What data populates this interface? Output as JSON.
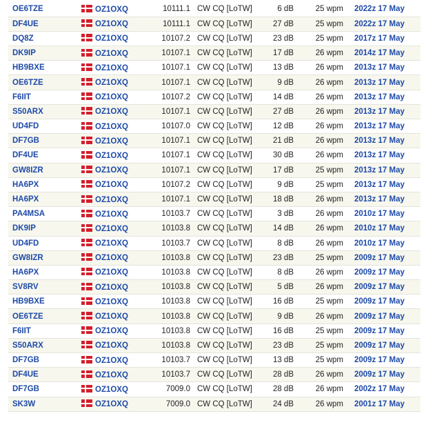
{
  "flag_colors": {
    "red": "#d21f2b",
    "cross": "#ffffff"
  },
  "rows": [
    {
      "spotter": "OE6TZE",
      "dx": "OZ1OXQ",
      "freq": "10111.1",
      "mode": "CW CQ [LoTW]",
      "snr": "6 dB",
      "speed": "25 wpm",
      "time": "2022z 17 May"
    },
    {
      "spotter": "DF4UE",
      "dx": "OZ1OXQ",
      "freq": "10111.1",
      "mode": "CW CQ [LoTW]",
      "snr": "27 dB",
      "speed": "25 wpm",
      "time": "2022z 17 May"
    },
    {
      "spotter": "DQ8Z",
      "dx": "OZ1OXQ",
      "freq": "10107.2",
      "mode": "CW CQ [LoTW]",
      "snr": "23 dB",
      "speed": "25 wpm",
      "time": "2017z 17 May"
    },
    {
      "spotter": "DK9IP",
      "dx": "OZ1OXQ",
      "freq": "10107.1",
      "mode": "CW CQ [LoTW]",
      "snr": "17 dB",
      "speed": "26 wpm",
      "time": "2014z 17 May"
    },
    {
      "spotter": "HB9BXE",
      "dx": "OZ1OXQ",
      "freq": "10107.1",
      "mode": "CW CQ [LoTW]",
      "snr": "13 dB",
      "speed": "26 wpm",
      "time": "2013z 17 May"
    },
    {
      "spotter": "OE6TZE",
      "dx": "OZ1OXQ",
      "freq": "10107.1",
      "mode": "CW CQ [LoTW]",
      "snr": "9 dB",
      "speed": "26 wpm",
      "time": "2013z 17 May"
    },
    {
      "spotter": "F6IIT",
      "dx": "OZ1OXQ",
      "freq": "10107.2",
      "mode": "CW CQ [LoTW]",
      "snr": "14 dB",
      "speed": "26 wpm",
      "time": "2013z 17 May"
    },
    {
      "spotter": "S50ARX",
      "dx": "OZ1OXQ",
      "freq": "10107.1",
      "mode": "CW CQ [LoTW]",
      "snr": "27 dB",
      "speed": "26 wpm",
      "time": "2013z 17 May"
    },
    {
      "spotter": "UD4FD",
      "dx": "OZ1OXQ",
      "freq": "10107.0",
      "mode": "CW CQ [LoTW]",
      "snr": "12 dB",
      "speed": "26 wpm",
      "time": "2013z 17 May"
    },
    {
      "spotter": "DF7GB",
      "dx": "OZ1OXQ",
      "freq": "10107.1",
      "mode": "CW CQ [LoTW]",
      "snr": "21 dB",
      "speed": "26 wpm",
      "time": "2013z 17 May"
    },
    {
      "spotter": "DF4UE",
      "dx": "OZ1OXQ",
      "freq": "10107.1",
      "mode": "CW CQ [LoTW]",
      "snr": "30 dB",
      "speed": "26 wpm",
      "time": "2013z 17 May"
    },
    {
      "spotter": "GW8IZR",
      "dx": "OZ1OXQ",
      "freq": "10107.1",
      "mode": "CW CQ [LoTW]",
      "snr": "17 dB",
      "speed": "25 wpm",
      "time": "2013z 17 May"
    },
    {
      "spotter": "HA6PX",
      "dx": "OZ1OXQ",
      "freq": "10107.2",
      "mode": "CW CQ [LoTW]",
      "snr": "9 dB",
      "speed": "25 wpm",
      "time": "2013z 17 May"
    },
    {
      "spotter": "HA6PX",
      "dx": "OZ1OXQ",
      "freq": "10107.1",
      "mode": "CW CQ [LoTW]",
      "snr": "18 dB",
      "speed": "26 wpm",
      "time": "2013z 17 May"
    },
    {
      "spotter": "PA4MSA",
      "dx": "OZ1OXQ",
      "freq": "10103.7",
      "mode": "CW CQ [LoTW]",
      "snr": "3 dB",
      "speed": "26 wpm",
      "time": "2010z 17 May"
    },
    {
      "spotter": "DK9IP",
      "dx": "OZ1OXQ",
      "freq": "10103.8",
      "mode": "CW CQ [LoTW]",
      "snr": "14 dB",
      "speed": "26 wpm",
      "time": "2010z 17 May"
    },
    {
      "spotter": "UD4FD",
      "dx": "OZ1OXQ",
      "freq": "10103.7",
      "mode": "CW CQ [LoTW]",
      "snr": "8 dB",
      "speed": "26 wpm",
      "time": "2010z 17 May"
    },
    {
      "spotter": "GW8IZR",
      "dx": "OZ1OXQ",
      "freq": "10103.8",
      "mode": "CW CQ [LoTW]",
      "snr": "23 dB",
      "speed": "25 wpm",
      "time": "2009z 17 May"
    },
    {
      "spotter": "HA6PX",
      "dx": "OZ1OXQ",
      "freq": "10103.8",
      "mode": "CW CQ [LoTW]",
      "snr": "8 dB",
      "speed": "26 wpm",
      "time": "2009z 17 May"
    },
    {
      "spotter": "SV8RV",
      "dx": "OZ1OXQ",
      "freq": "10103.8",
      "mode": "CW CQ [LoTW]",
      "snr": "5 dB",
      "speed": "26 wpm",
      "time": "2009z 17 May"
    },
    {
      "spotter": "HB9BXE",
      "dx": "OZ1OXQ",
      "freq": "10103.8",
      "mode": "CW CQ [LoTW]",
      "snr": "16 dB",
      "speed": "25 wpm",
      "time": "2009z 17 May"
    },
    {
      "spotter": "OE6TZE",
      "dx": "OZ1OXQ",
      "freq": "10103.8",
      "mode": "CW CQ [LoTW]",
      "snr": "9 dB",
      "speed": "26 wpm",
      "time": "2009z 17 May"
    },
    {
      "spotter": "F6IIT",
      "dx": "OZ1OXQ",
      "freq": "10103.8",
      "mode": "CW CQ [LoTW]",
      "snr": "16 dB",
      "speed": "25 wpm",
      "time": "2009z 17 May"
    },
    {
      "spotter": "S50ARX",
      "dx": "OZ1OXQ",
      "freq": "10103.8",
      "mode": "CW CQ [LoTW]",
      "snr": "23 dB",
      "speed": "25 wpm",
      "time": "2009z 17 May"
    },
    {
      "spotter": "DF7GB",
      "dx": "OZ1OXQ",
      "freq": "10103.7",
      "mode": "CW CQ [LoTW]",
      "snr": "13 dB",
      "speed": "25 wpm",
      "time": "2009z 17 May"
    },
    {
      "spotter": "DF4UE",
      "dx": "OZ1OXQ",
      "freq": "10103.7",
      "mode": "CW CQ [LoTW]",
      "snr": "28 dB",
      "speed": "26 wpm",
      "time": "2009z 17 May"
    },
    {
      "spotter": "DF7GB",
      "dx": "OZ1OXQ",
      "freq": "7009.0",
      "mode": "CW CQ [LoTW]",
      "snr": "28 dB",
      "speed": "26 wpm",
      "time": "2002z 17 May"
    },
    {
      "spotter": "SK3W",
      "dx": "OZ1OXQ",
      "freq": "7009.0",
      "mode": "CW CQ [LoTW]",
      "snr": "24 dB",
      "speed": "26 wpm",
      "time": "2001z 17 May"
    }
  ]
}
